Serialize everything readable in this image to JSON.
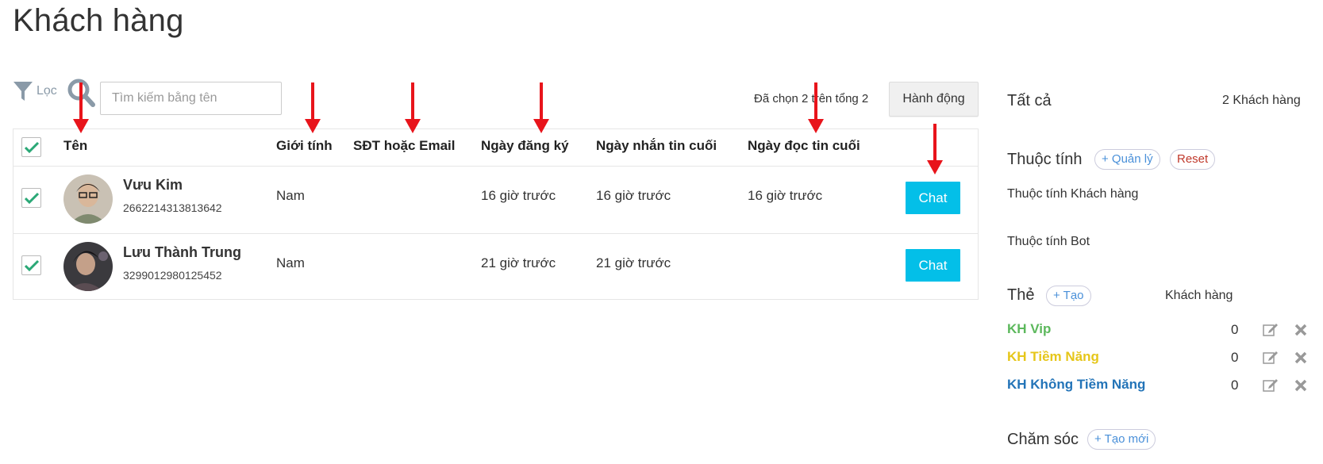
{
  "page": {
    "title": "Khách hàng"
  },
  "toolbar": {
    "filter_label": "Lọc",
    "search_placeholder": "Tìm kiếm bằng tên",
    "selection_info": "Đã chọn 2 trên tổng 2",
    "action_label": "Hành động"
  },
  "table": {
    "headers": {
      "name": "Tên",
      "gender": "Giới tính",
      "contact": "SĐT hoặc Email",
      "registered": "Ngày đăng ký",
      "last_message": "Ngày nhắn tin cuối",
      "last_read": "Ngày đọc tin cuối"
    },
    "rows": [
      {
        "name": "Vưu Kim",
        "id": "2662214313813642",
        "gender": "Nam",
        "contact": "",
        "registered": "16 giờ trước",
        "last_message": "16 giờ trước",
        "last_read": "16 giờ trước",
        "action": "Chat",
        "checked": true
      },
      {
        "name": "Lưu Thành Trung",
        "id": "3299012980125452",
        "gender": "Nam",
        "contact": "",
        "registered": "21 giờ trước",
        "last_message": "21 giờ trước",
        "last_read": "",
        "action": "Chat",
        "checked": true
      }
    ]
  },
  "sidebar": {
    "all_label": "Tất cả",
    "all_count": "2 Khách hàng",
    "attributes": {
      "label": "Thuộc tính",
      "manage_button": "+ Quản lý",
      "reset_button": "Reset",
      "customer_attr": "Thuộc tính Khách hàng",
      "bot_attr": "Thuộc tính Bot"
    },
    "tags": {
      "label": "Thẻ",
      "create_button": "+ Tạo",
      "column_label": "Khách hàng",
      "items": [
        {
          "name": "KH Vip",
          "count": "0",
          "color": "#5cb85c"
        },
        {
          "name": "KH Tiềm Năng",
          "count": "0",
          "color": "#e6c619"
        },
        {
          "name": "KH Không Tiềm Năng",
          "count": "0",
          "color": "#2374b8"
        }
      ]
    },
    "care": {
      "label": "Chăm sóc",
      "create_button": "+ Tạo mới"
    }
  },
  "colors": {
    "accent": "#03bfe8",
    "check": "#2aa876",
    "arrow": "#e8141b"
  }
}
